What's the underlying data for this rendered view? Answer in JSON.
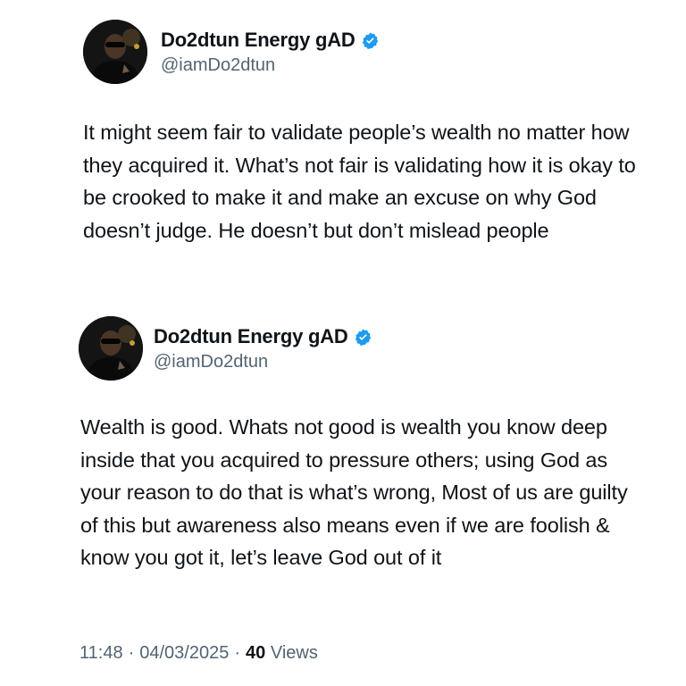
{
  "tweets": [
    {
      "author": {
        "display_name": "Do2dtun Energy gAD",
        "handle": "@iamDo2dtun",
        "verified": true,
        "avatar_icon": "profile-avatar"
      },
      "text": "It might seem fair to validate people’s wealth no matter how they acquired it. What’s not fair is validating how it is okay to be crooked to make it and make an excuse on why God doesn’t judge. He doesn’t but don’t mislead people"
    },
    {
      "author": {
        "display_name": "Do2dtun Energy gAD",
        "handle": "@iamDo2dtun",
        "verified": true,
        "avatar_icon": "profile-avatar"
      },
      "text": "Wealth is good. Whats not good is wealth you know deep inside that you acquired to pressure others; using God as your reason to do that is what’s wrong, Most of us are guilty of this but awareness also means even if we are foolish & know you got it, let’s leave God out of it"
    }
  ],
  "meta": {
    "time": "11:48",
    "separator": "·",
    "date": "04/03/2025",
    "views_count": "40",
    "views_label": "Views"
  },
  "colors": {
    "text_primary": "#0f1419",
    "text_secondary": "#536471",
    "verified_badge": "#1d9bf0",
    "background": "#ffffff"
  }
}
